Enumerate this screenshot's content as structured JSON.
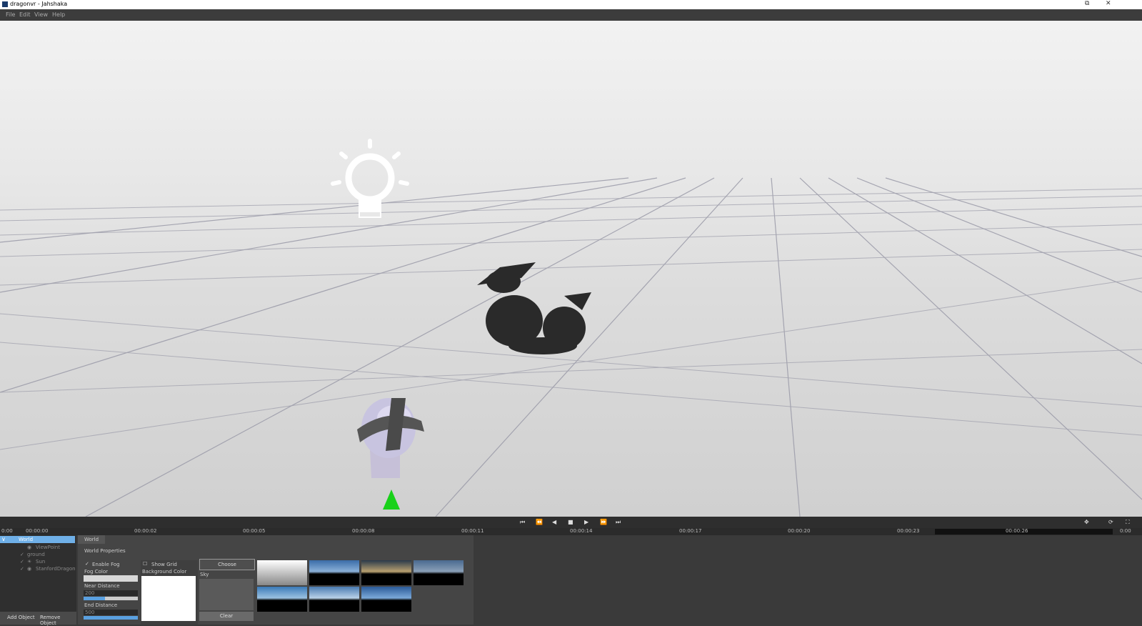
{
  "window": {
    "title": "dragonvr - Jahshaka",
    "restore_icon": "restore-icon",
    "close_icon": "close-icon"
  },
  "menu": [
    "File",
    "Edit",
    "View",
    "Help"
  ],
  "transport": {
    "buttons": [
      "skip-start-icon",
      "rewind-icon",
      "step-back-icon",
      "stop-icon",
      "play-icon",
      "fast-forward-icon",
      "skip-end-icon"
    ]
  },
  "timeline": {
    "start": "0:00",
    "end": "0:00",
    "ticks": [
      "00:00:00",
      "00:00:02",
      "00:00:05",
      "00:00:08",
      "00:00:11",
      "00:00:14",
      "00:00:17",
      "00:00:20",
      "00:00:23",
      "00:00:26"
    ]
  },
  "outliner": {
    "root": "World",
    "items": [
      "ViewPoint",
      "ground",
      "Sun",
      "StanfordDragon"
    ],
    "add_button": "Add Object",
    "remove_button": "Remove Object"
  },
  "properties": {
    "tab": "World",
    "section": "World Properties",
    "enable_fog": "Enable Fog",
    "fog_color": "Fog Color",
    "near_distance": "Near Distance",
    "near_value": "200",
    "end_distance": "End Distance",
    "end_value": "500",
    "show_grid": "Show Grid",
    "background_color": "Background Color",
    "choose_button": "Choose",
    "sky_label": "Sky",
    "clear_button": "Clear"
  },
  "colors": {
    "accent": "#5aa0e0",
    "selected": "#6fb0e8",
    "panel": "#454545"
  }
}
